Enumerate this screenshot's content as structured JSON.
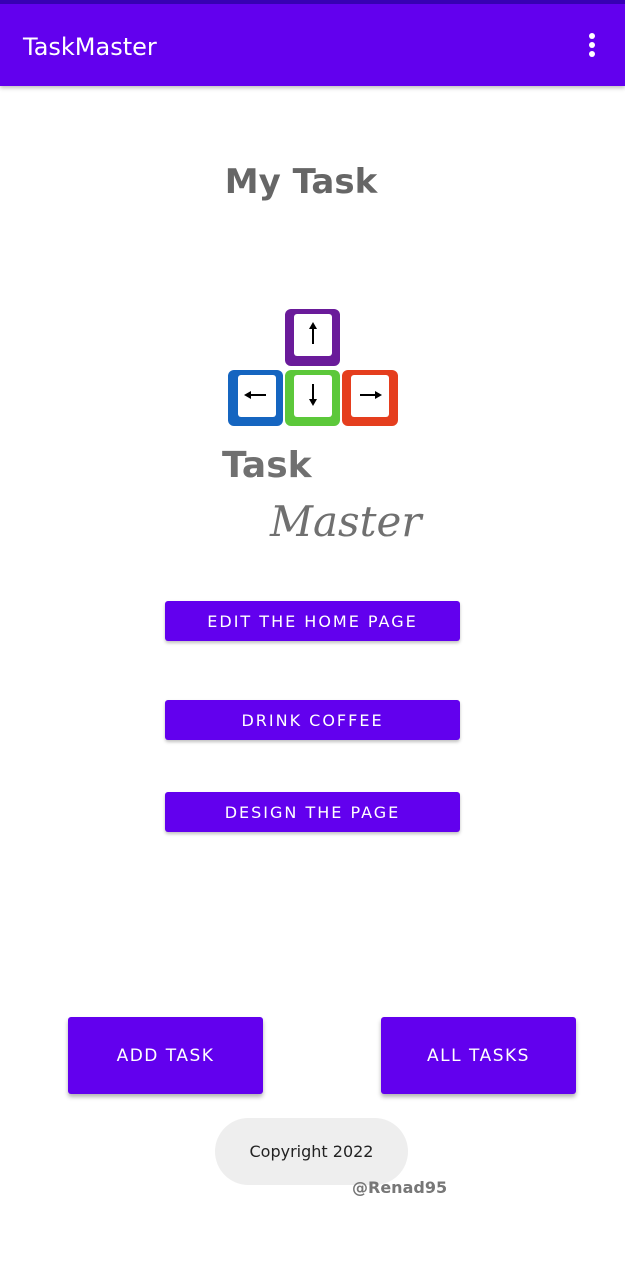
{
  "app": {
    "title": "TaskMaster"
  },
  "page": {
    "title": "My Task"
  },
  "logo": {
    "word1": "Task",
    "word2": "Master",
    "colors": {
      "up": "#6a1b9a",
      "left": "#1565c0",
      "down": "#5cc83a",
      "right": "#e53e1e",
      "text": "#707070"
    }
  },
  "tasks": [
    "EDIT THE HOME PAGE",
    "DRINK COFFEE",
    "DESIGN THE PAGE"
  ],
  "actions": {
    "add_task": "ADD TASK",
    "all_tasks": "ALL TASKS"
  },
  "footer": {
    "copyright": "Copyright 2022",
    "handle": "@Renad95"
  },
  "theme": {
    "primary": "#6200ee",
    "primary_dark": "#3700b3"
  }
}
